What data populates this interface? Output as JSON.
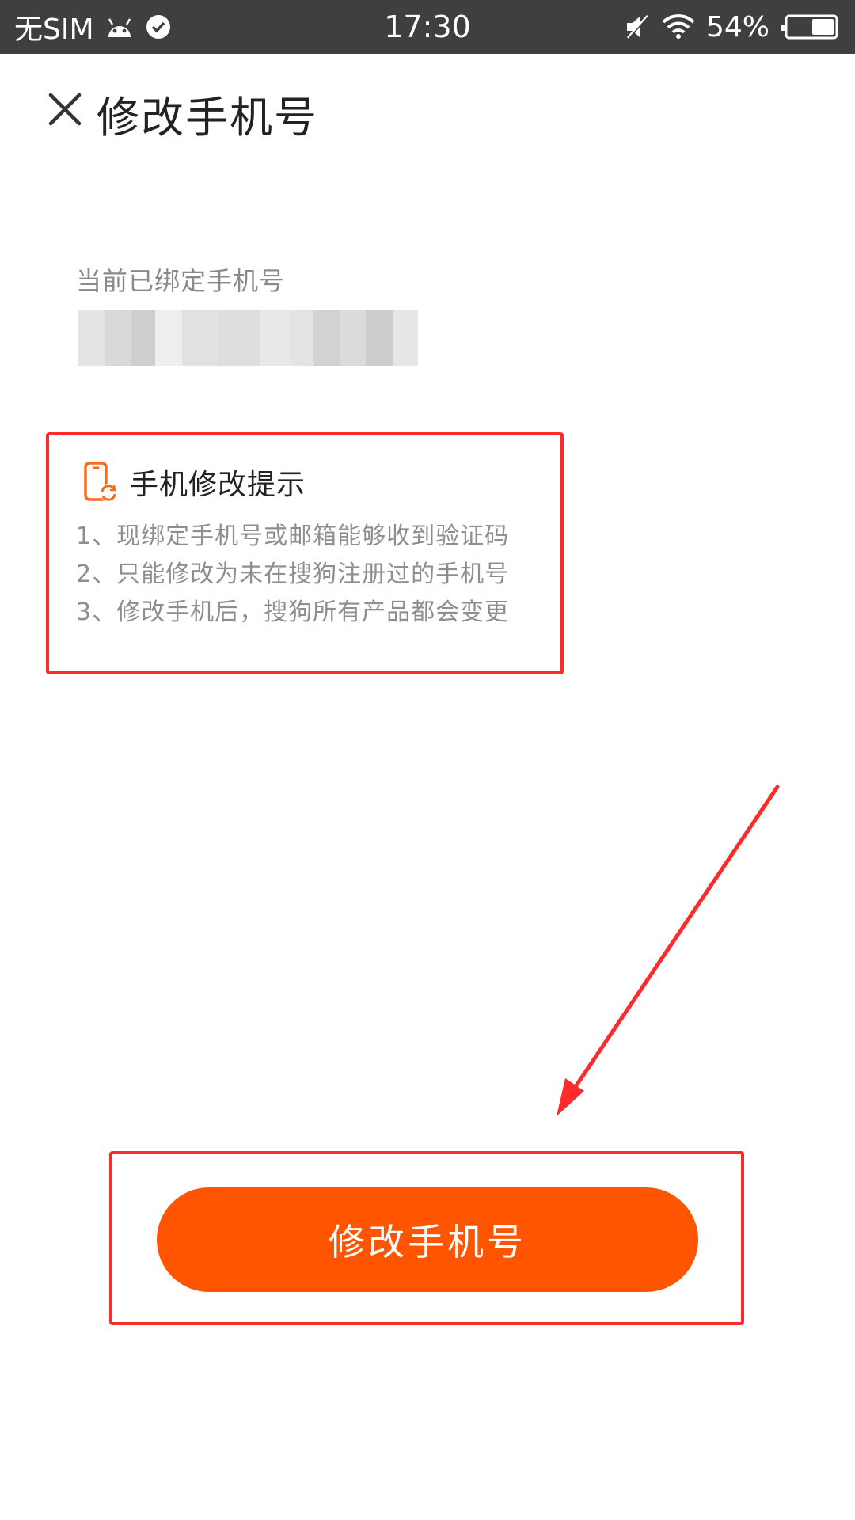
{
  "status_bar": {
    "carrier": "无SIM",
    "time": "17:30",
    "battery": "54%",
    "icons": [
      "android-icon",
      "check-circle-icon",
      "mute-icon",
      "wifi-icon",
      "battery-icon"
    ]
  },
  "header": {
    "close_icon": "close-icon",
    "title": "修改手机号"
  },
  "current_phone": {
    "label": "当前已绑定手机号"
  },
  "tips": {
    "icon": "phone-refresh-icon",
    "title": "手机修改提示",
    "items": [
      "1、现绑定手机号或邮箱能够收到验证码",
      "2、只能修改为未在搜狗注册过的手机号",
      "3、修改手机后，搜狗所有产品都会变更"
    ]
  },
  "button": {
    "label": "修改手机号"
  },
  "colors": {
    "accent": "#ff5500",
    "annotation": "#ff2a2a",
    "status_bar": "#3f3f3f"
  }
}
